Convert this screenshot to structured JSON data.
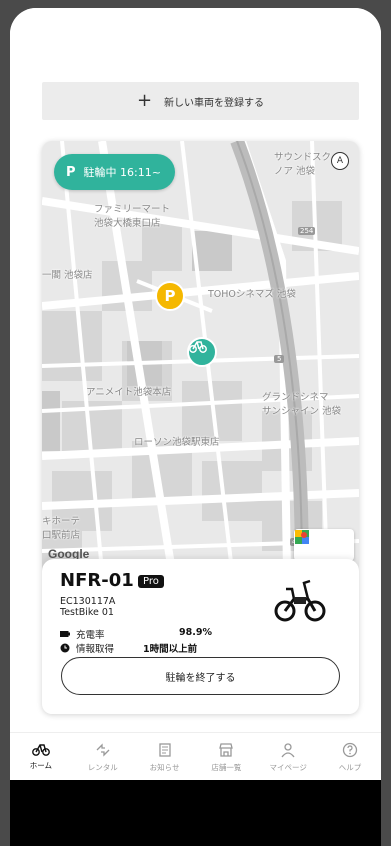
{
  "register": {
    "plus_icon": "plus-icon",
    "label": "新しい車両を登録する"
  },
  "map": {
    "parking_badge": {
      "p": "P",
      "text": "駐輪中 16:11~"
    },
    "compass": "A",
    "labels": {
      "family_mart": "ファミリーマート\n池袋大橋東口店",
      "ikebukuro": "一閣 池袋店",
      "toho": "TOHOシネマズ 池袋",
      "animate": "アニメイト池袋本店",
      "grand": "グランドシネマ\nサンシャイン 池袋",
      "lawson": "ローソン池袋駅東店",
      "sunshine": "サウンドスク\nノア 池袋",
      "kihota": "キホーテ\n口駅前店",
      "route254": "254",
      "route5": "5",
      "route435": "435"
    },
    "google": "Google",
    "pin_p": "P"
  },
  "bike": {
    "name": "NFR-01",
    "badge": "Pro",
    "serial": "EC130117A",
    "nickname": "TestBike 01",
    "battery_label": "充電率",
    "battery_value": "98.9%",
    "updated_label": "情報取得",
    "updated_value": "1時間以上前",
    "end_button": "駐輪を終了する"
  },
  "tabs": [
    {
      "label": "ホーム",
      "icon": "bike-icon",
      "active": true
    },
    {
      "label": "レンタル",
      "icon": "swap-icon",
      "active": false
    },
    {
      "label": "お知らせ",
      "icon": "news-icon",
      "active": false
    },
    {
      "label": "店舗一覧",
      "icon": "store-icon",
      "active": false
    },
    {
      "label": "マイページ",
      "icon": "person-icon",
      "active": false
    },
    {
      "label": "ヘルプ",
      "icon": "help-icon",
      "active": false
    }
  ],
  "colors": {
    "accent": "#30b39c",
    "parking": "#f5b800"
  }
}
